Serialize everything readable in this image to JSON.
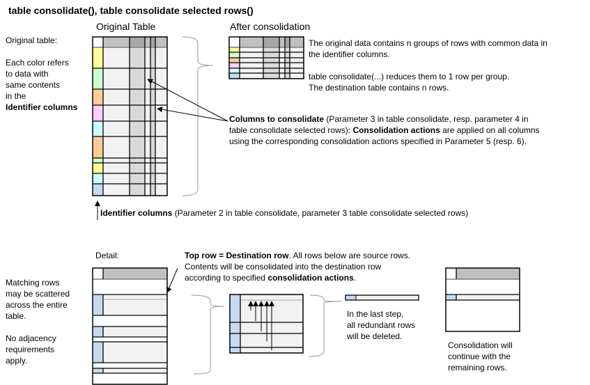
{
  "title": "table consolidate(), table consolidate selected rows()",
  "headings": {
    "original_table": "Original Table",
    "after_consolidation": "After consolidation",
    "detail": "Detail:"
  },
  "left_notes": {
    "original_table_label": "Original table:",
    "color_note_lines": [
      "Each color refers",
      "to data with",
      "same contents",
      "in the"
    ],
    "color_note_bold": "Identifier columns",
    "matching_lines": [
      "Matching rows",
      "may be scattered",
      "across the entire",
      "table."
    ],
    "adjacency_lines": [
      "No adjacency",
      "requirements",
      "apply."
    ]
  },
  "after_notes": {
    "line1": "The original data contains n groups of rows with common data in",
    "line2": "the identifier columns.",
    "line3": "table consolidate(...) reduces them to 1 row per group.",
    "line4": "The destination table contains n rows."
  },
  "columns_note": {
    "bold1": "Columns to consolidate",
    "text1": " (Parameter  3 in table consolidate, resp. parameter  4 in",
    "text2a": "table consolidate selected rows): ",
    "bold2": "Consolidation actions",
    "text2b": " are applied on all columns",
    "text3": "using the corresponding  consolidation actions specified in Parameter 5 (resp. 6)."
  },
  "identifier_note": {
    "bold": "Identifier columns",
    "text": " (Parameter 2 in table consolidate, parameter 3 table consolidate selected rows)"
  },
  "detail_note": {
    "bold1": "Top row = Destination row",
    "text1": ".  All rows below are source rows.",
    "text2": "Contents will be consolidated into the destination row",
    "text3a": "according to specified ",
    "bold2": "consolidation actions",
    "text3b": "."
  },
  "last_step_lines": [
    "In the last step,",
    "all redundant rows",
    "will be deleted."
  ],
  "continue_lines": [
    "Consolidation will",
    "continue with the",
    "remaining rows."
  ],
  "colors": {
    "yellow": "#ffff99",
    "green": "#ccffcc",
    "orange": "#ffcc99",
    "pink": "#ffccff",
    "cyan": "#ccffff",
    "blue": "#c5d9f1",
    "header_gray": "#c0c0c0",
    "header_dark": "#a6a6a6",
    "cell_light": "#f2f2f2",
    "cell_mid": "#d9d9d9",
    "brace_gray": "#a6a6a6"
  },
  "original_row_colors": [
    "yellow",
    "green",
    "orange",
    "pink",
    "cyan",
    "orange",
    "green",
    "yellow",
    "cyan",
    "blue"
  ],
  "after_row_colors": [
    "yellow",
    "green",
    "orange",
    "pink",
    "cyan",
    "blue"
  ]
}
